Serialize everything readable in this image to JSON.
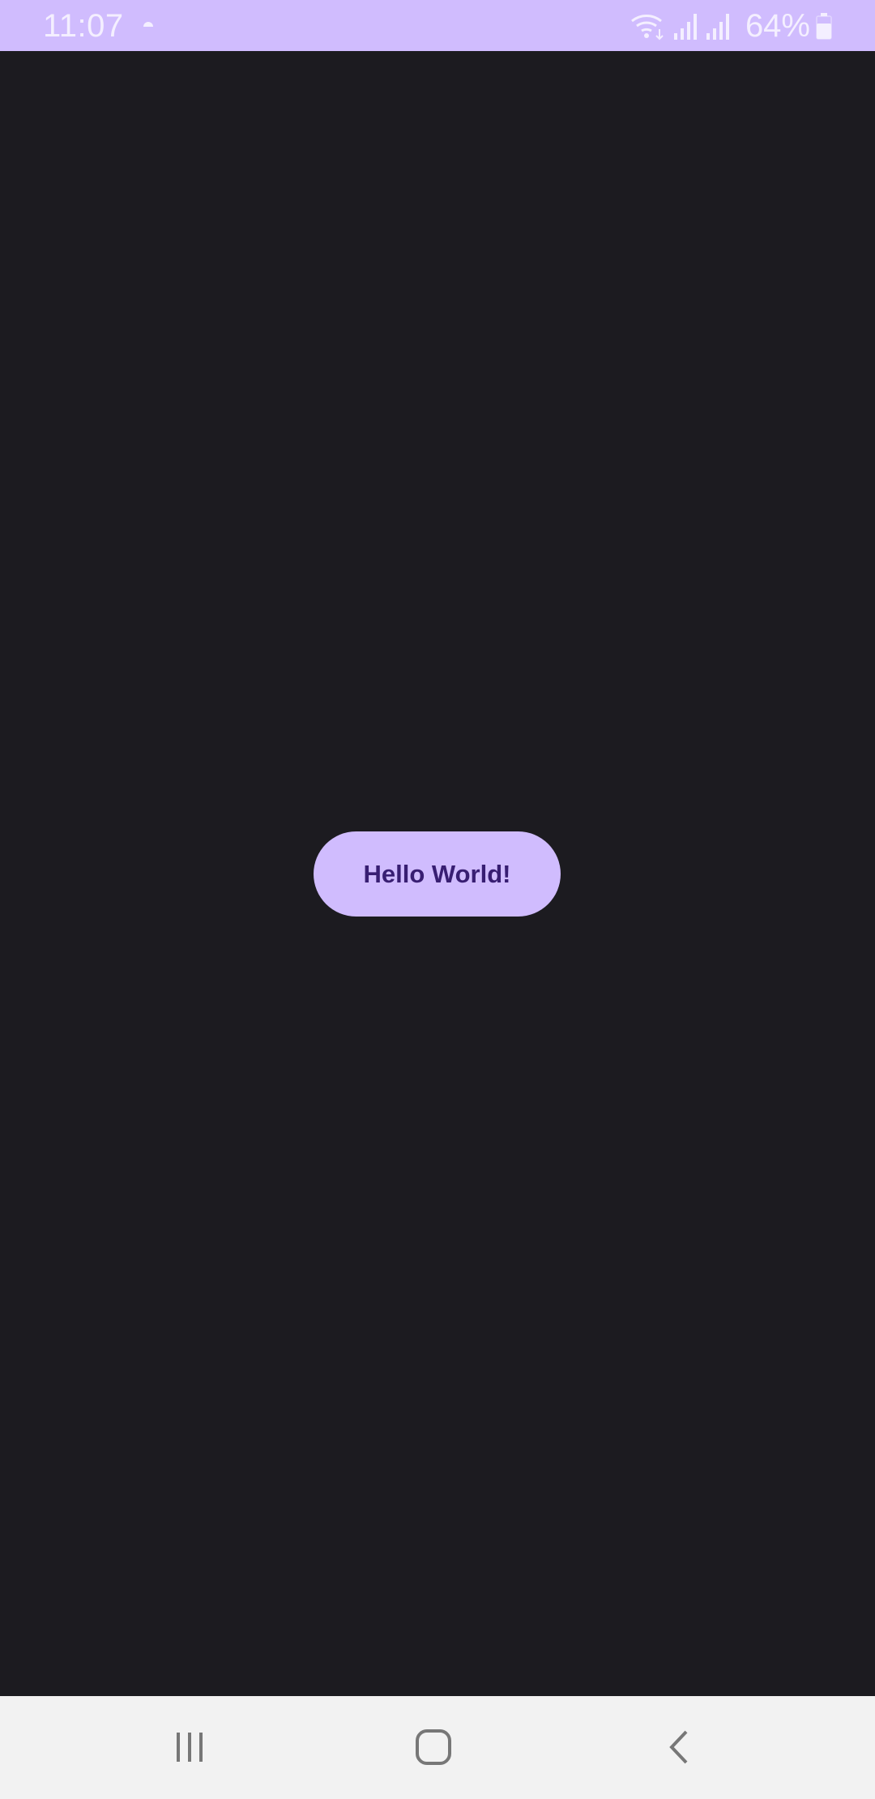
{
  "status_bar": {
    "time": "11:07",
    "battery_percent": "64%",
    "battery_level": 0.64,
    "notification_icon": "weather-icon",
    "icons": [
      "wifi-icon",
      "signal-icon",
      "signal-icon",
      "battery-icon"
    ],
    "background_color": "#d0bcfe"
  },
  "main": {
    "background_color": "#1c1b20",
    "button": {
      "label": "Hello World!",
      "background_color": "#d0bcfe",
      "text_color": "#381e72"
    }
  },
  "nav_bar": {
    "background_color": "#f2f2f2",
    "buttons": [
      "recents-icon",
      "home-icon",
      "back-icon"
    ]
  }
}
